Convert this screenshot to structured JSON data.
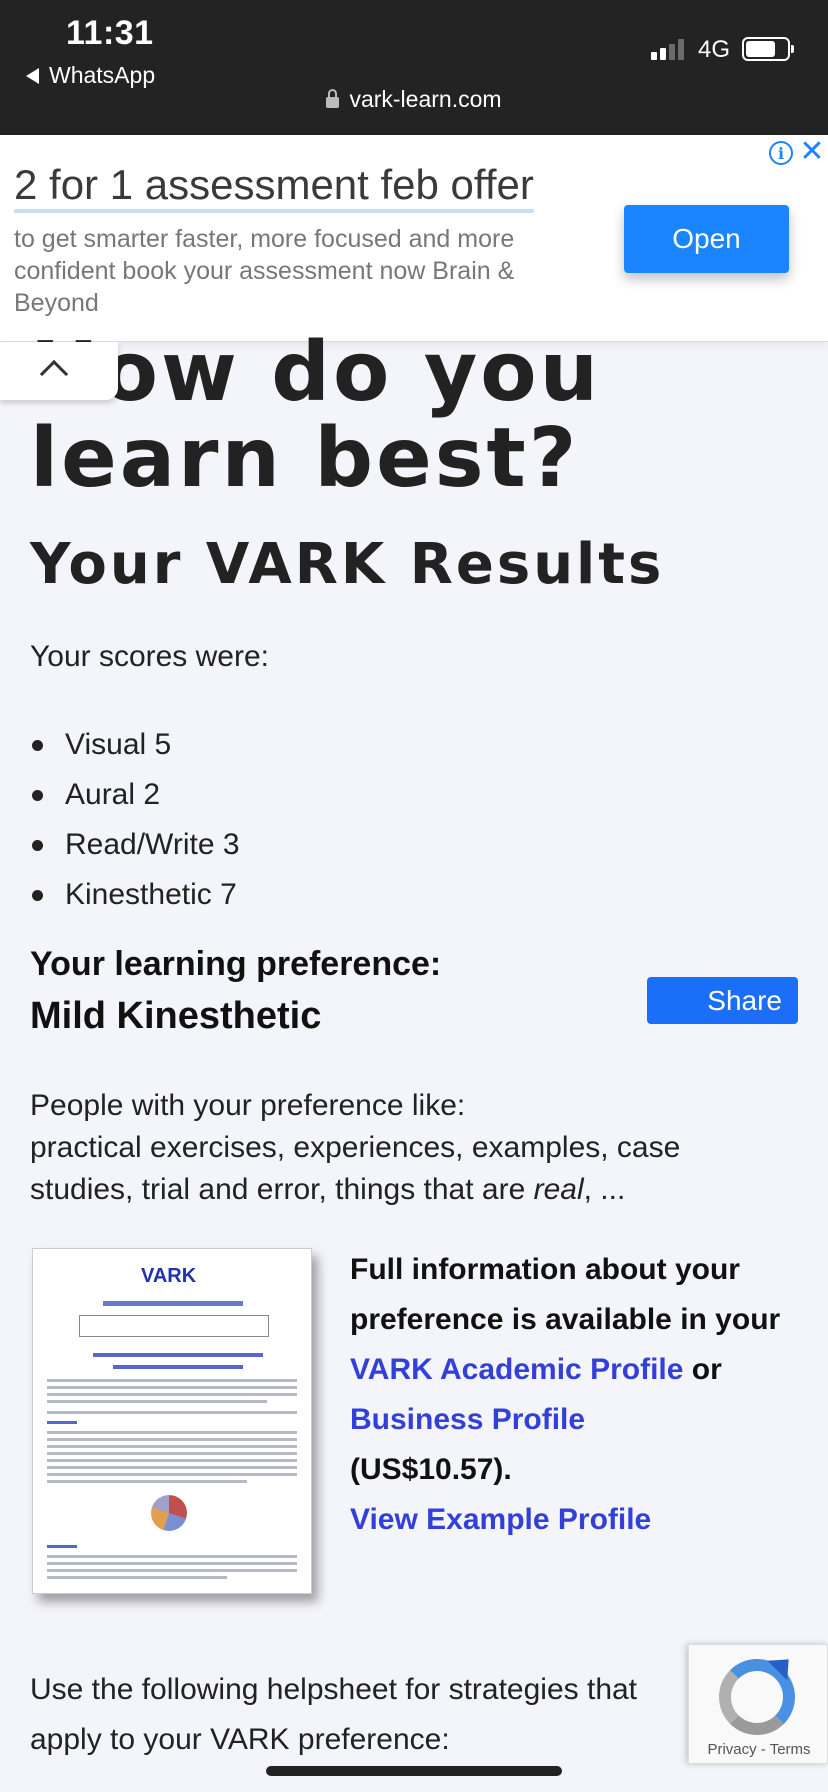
{
  "status_bar": {
    "time": "11:31",
    "back_app": "WhatsApp",
    "network": "4G",
    "url": "vark-learn.com"
  },
  "ad": {
    "title": "2 for 1 assessment feb offer",
    "description": "to get smarter faster, more focused and more confident book your assessment now Brain & Beyond",
    "open_label": "Open",
    "info_glyph": "i",
    "close_glyph": "✕"
  },
  "page": {
    "headline_line1": "How do you",
    "headline_line2": "learn best?",
    "results_title": "Your VARK Results",
    "scores_intro": "Your scores were:",
    "scores": [
      {
        "label": "Visual 5"
      },
      {
        "label": "Aural 2"
      },
      {
        "label": "Read/Write 3"
      },
      {
        "label": "Kinesthetic 7"
      }
    ],
    "preference_label": "Your learning preference:",
    "preference_value": "Mild Kinesthetic",
    "share_label": "Share",
    "people_intro": "People with your preference like:",
    "people_text": "practical exercises, experiences, examples, case studies, trial and error, things that are ",
    "people_em": "real",
    "people_tail": ", ...",
    "thumbnail_logo": "VARK",
    "info_text_1": "Full information about your preference is available in your ",
    "academic_profile_link": "VARK Academic Profile",
    "info_text_or": " or ",
    "business_profile_link": "Business Profile",
    "price": "(US$10.57).",
    "example_profile_link": "View Example Profile",
    "helpsheet_text": "Use the following helpsheet for strategies that apply to your VARK preference:"
  },
  "recaptcha": {
    "privacy": "Privacy",
    "separator": " - ",
    "terms": "Terms"
  },
  "colors": {
    "link": "#3340d8",
    "ad_button": "#1a85ff",
    "share_button": "#1a6ef7"
  }
}
